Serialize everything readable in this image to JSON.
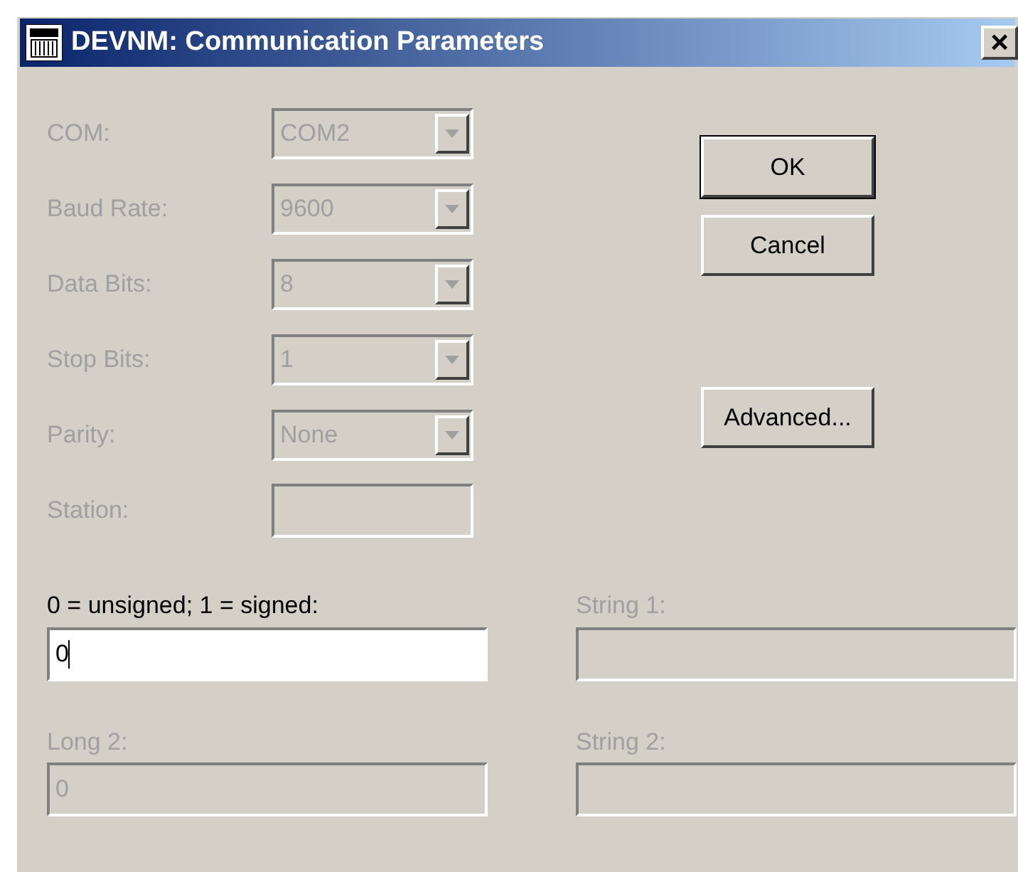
{
  "window": {
    "title": "DEVNM: Communication Parameters",
    "close": "×"
  },
  "settings": [
    {
      "label": "COM:",
      "value": "COM2",
      "kind": "dropdown",
      "disabled": true
    },
    {
      "label": "Baud Rate:",
      "value": "9600",
      "kind": "dropdown",
      "disabled": true
    },
    {
      "label": "Data Bits:",
      "value": "8",
      "kind": "dropdown",
      "disabled": true
    },
    {
      "label": "Stop Bits:",
      "value": "1",
      "kind": "dropdown",
      "disabled": true
    },
    {
      "label": "Parity:",
      "value": "None",
      "kind": "dropdown",
      "disabled": true
    },
    {
      "label": "Station:",
      "kind": "field",
      "disabled": true
    }
  ],
  "buttons": [
    {
      "label": "OK",
      "default": true
    },
    {
      "label": "Cancel",
      "default": false
    },
    {
      "label": "Advanced...",
      "default": false
    }
  ],
  "fields": [
    {
      "label": "0 = unsigned; 1 = signed:",
      "value": "0",
      "disabled": false
    },
    {
      "label": "String 1:",
      "disabled": true
    },
    {
      "label": "Long 2:",
      "value": "0",
      "disabled": true
    },
    {
      "label": "String 2:",
      "disabled": true
    }
  ]
}
